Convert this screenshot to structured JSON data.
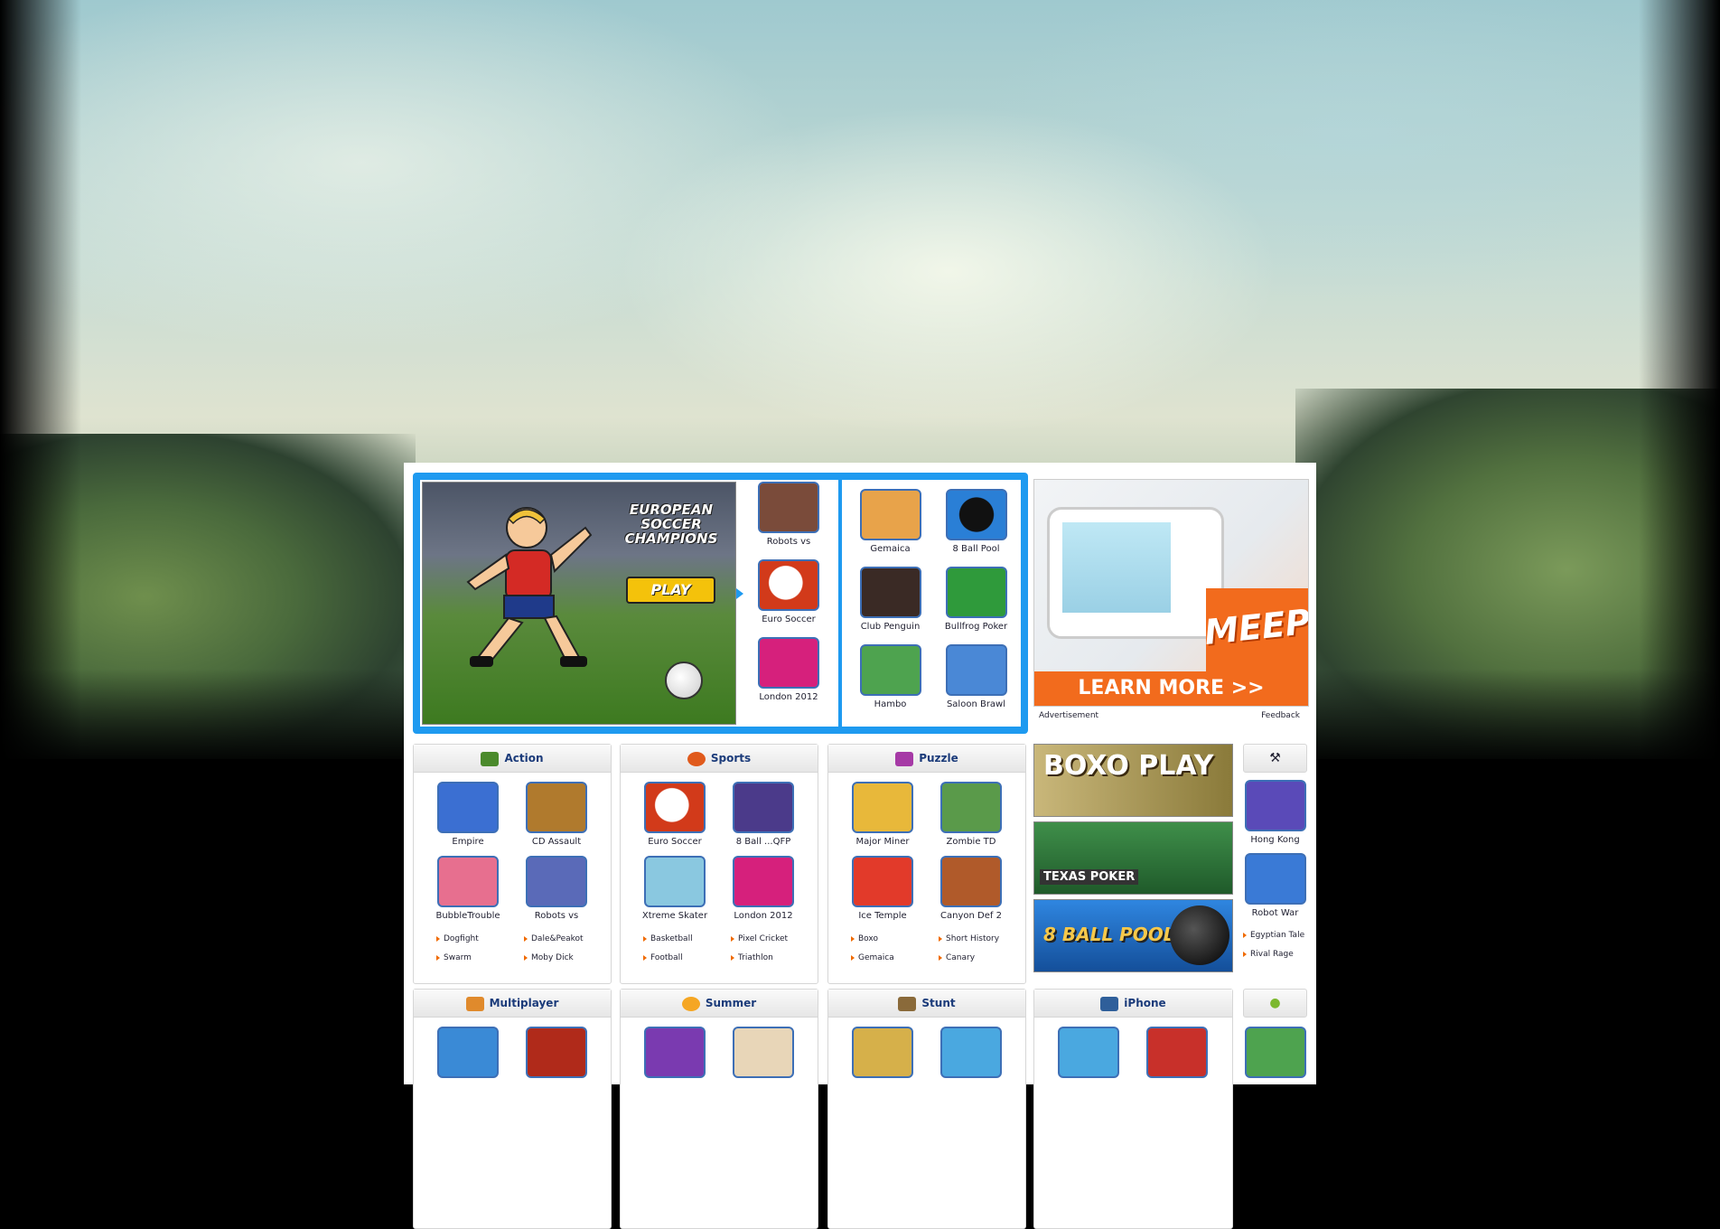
{
  "featured": {
    "hero_title": "EUROPEAN SOCCER CHAMPIONS",
    "hero_play": "PLAY",
    "list": [
      {
        "label": "Robots vs",
        "icon": "robot-game-icon",
        "color": "#7a4b3a"
      },
      {
        "label": "Euro Soccer",
        "icon": "soccer-ball-icon",
        "color": "#d23a1a"
      },
      {
        "label": "London 2012",
        "icon": "olympics-logo-icon",
        "color": "#d6207c"
      }
    ],
    "grid": [
      {
        "label": "Gemaica",
        "icon": "pirate-game-icon",
        "color": "#e8a34a"
      },
      {
        "label": "8 Ball Pool",
        "icon": "eight-ball-icon",
        "color": "#2a7fd6"
      },
      {
        "label": "Club Penguin",
        "icon": "penguin-game-icon",
        "color": "#3a2a25"
      },
      {
        "label": "Bullfrog Poker",
        "icon": "poker-game-icon",
        "color": "#2f9a3b"
      },
      {
        "label": "Hambo",
        "icon": "pig-game-icon",
        "color": "#4ea34f"
      },
      {
        "label": "Saloon Brawl",
        "icon": "cowboy-game-icon",
        "color": "#4a88d6"
      }
    ]
  },
  "ad": {
    "brand": "MEEP!",
    "cta": "LEARN MORE >>",
    "caption_left": "Advertisement",
    "caption_right": "Feedback"
  },
  "categories": [
    {
      "title": "Action",
      "color": "#4b8a2c",
      "games": [
        {
          "label": "Empire",
          "color": "#3b6fd2"
        },
        {
          "label": "CD Assault",
          "color": "#b07a2d"
        },
        {
          "label": "BubbleTrouble",
          "color": "#e76f8f"
        },
        {
          "label": "Robots vs",
          "color": "#5a6ab8"
        }
      ],
      "links": [
        "Dogfight",
        "Dale&Peakot",
        "Swarm",
        "Moby Dick"
      ]
    },
    {
      "title": "Sports",
      "color": "#e05a1c",
      "games": [
        {
          "label": "Euro Soccer",
          "color": "#d23a1a"
        },
        {
          "label": "8 Ball ...QFP",
          "color": "#4b3a8a"
        },
        {
          "label": "Xtreme Skater",
          "color": "#8ac8e0"
        },
        {
          "label": "London 2012",
          "color": "#d6207c"
        }
      ],
      "links": [
        "Basketball",
        "Pixel Cricket",
        "Football",
        "Triathlon"
      ]
    },
    {
      "title": "Puzzle",
      "color": "#a63aa6",
      "games": [
        {
          "label": "Major Miner",
          "color": "#e8b83a"
        },
        {
          "label": "Zombie TD",
          "color": "#5a9a4a"
        },
        {
          "label": "Ice Temple",
          "color": "#e23a2a"
        },
        {
          "label": "Canyon Def 2",
          "color": "#b05a2a"
        }
      ],
      "links": [
        "Boxo",
        "Short History",
        "Gemaica",
        "Canary"
      ]
    },
    {
      "title": "Multiplayer",
      "color": "#e08a2c",
      "games": [
        {
          "label": "",
          "color": "#3a8ad6"
        },
        {
          "label": "",
          "color": "#b02a1a"
        }
      ],
      "links": []
    },
    {
      "title": "Summer",
      "color": "#f5a623",
      "games": [
        {
          "label": "",
          "color": "#7a3ab0"
        },
        {
          "label": "",
          "color": "#e8d6b8"
        }
      ],
      "links": []
    },
    {
      "title": "Stunt",
      "color": "#8a6a3a",
      "games": [
        {
          "label": "",
          "color": "#d6b04a"
        },
        {
          "label": "",
          "color": "#4aa8e0"
        }
      ],
      "links": []
    }
  ],
  "banners": [
    {
      "label": "BOXO PLAY",
      "color": "#8a7a3a",
      "icon": "boxo-banner"
    },
    {
      "label": "TEXAS POKER",
      "color": "#2f7a3b",
      "icon": "poker-banner"
    },
    {
      "label": "8 BALL POOL",
      "color": "#1f6fc8",
      "icon": "eight-ball-banner"
    }
  ],
  "iphone": {
    "title": "iPhone",
    "games": [
      {
        "color": "#4aa8e0"
      },
      {
        "color": "#c8302a"
      }
    ]
  },
  "side_top": {
    "games": [
      {
        "label": "Hong Kong",
        "color": "#5a4ab8"
      },
      {
        "label": "Robot War",
        "color": "#3a7ad6"
      }
    ],
    "links": [
      "Egyptian Tale",
      "Rival Rage"
    ]
  },
  "side_bottom": {
    "games": [
      {
        "color": "#4ea34f"
      }
    ]
  }
}
